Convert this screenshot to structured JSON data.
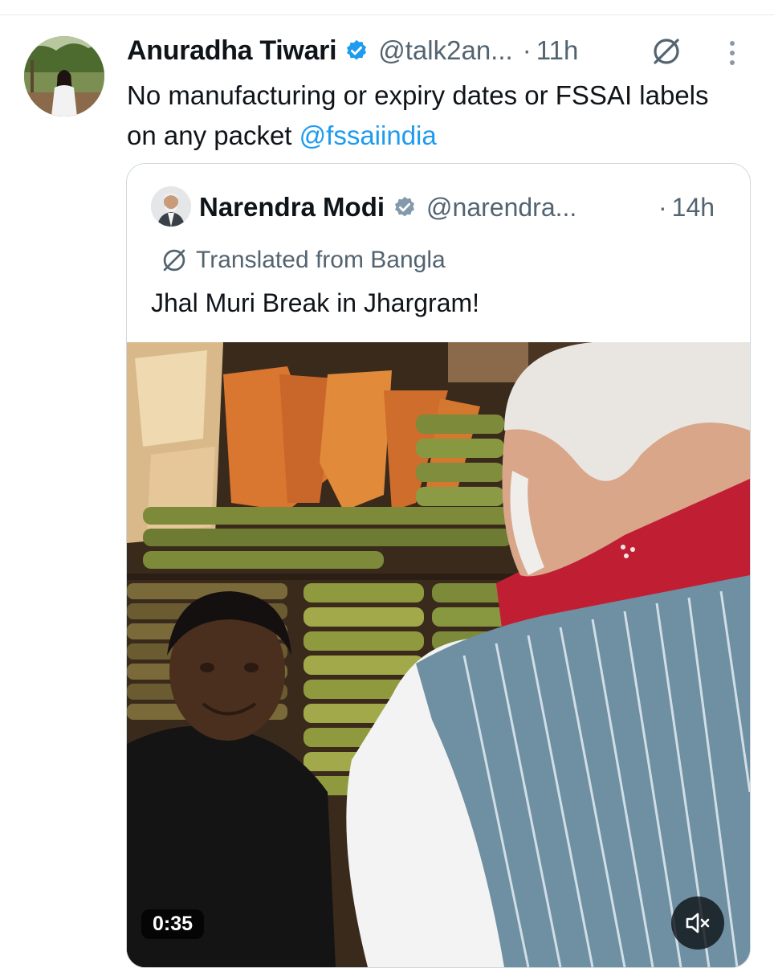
{
  "tweet": {
    "author_name": "Anuradha Tiwari",
    "handle": "@talk2an...",
    "separator": "·",
    "time": "11h",
    "text": "No manufacturing or expiry dates or FSSAI labels on any packet ",
    "mention": "@fssaiindia",
    "icons": {
      "verified": "verified-badge-icon",
      "translate": "translate-icon",
      "more": "more-options-icon"
    }
  },
  "quote": {
    "author_name": "Narendra Modi",
    "handle": "@narendra...",
    "separator": "·",
    "time": "14h",
    "translated_label": "Translated from Bangla",
    "text": "Jhal Muri Break in Jhargram!",
    "video": {
      "duration": "0:35",
      "muted": true
    }
  },
  "colors": {
    "text_primary": "#0f1419",
    "text_secondary": "#536471",
    "link": "#1d9bf0",
    "verified": "#1d9bf0",
    "quote_verified": "#829aab",
    "border": "#cfd9de"
  }
}
